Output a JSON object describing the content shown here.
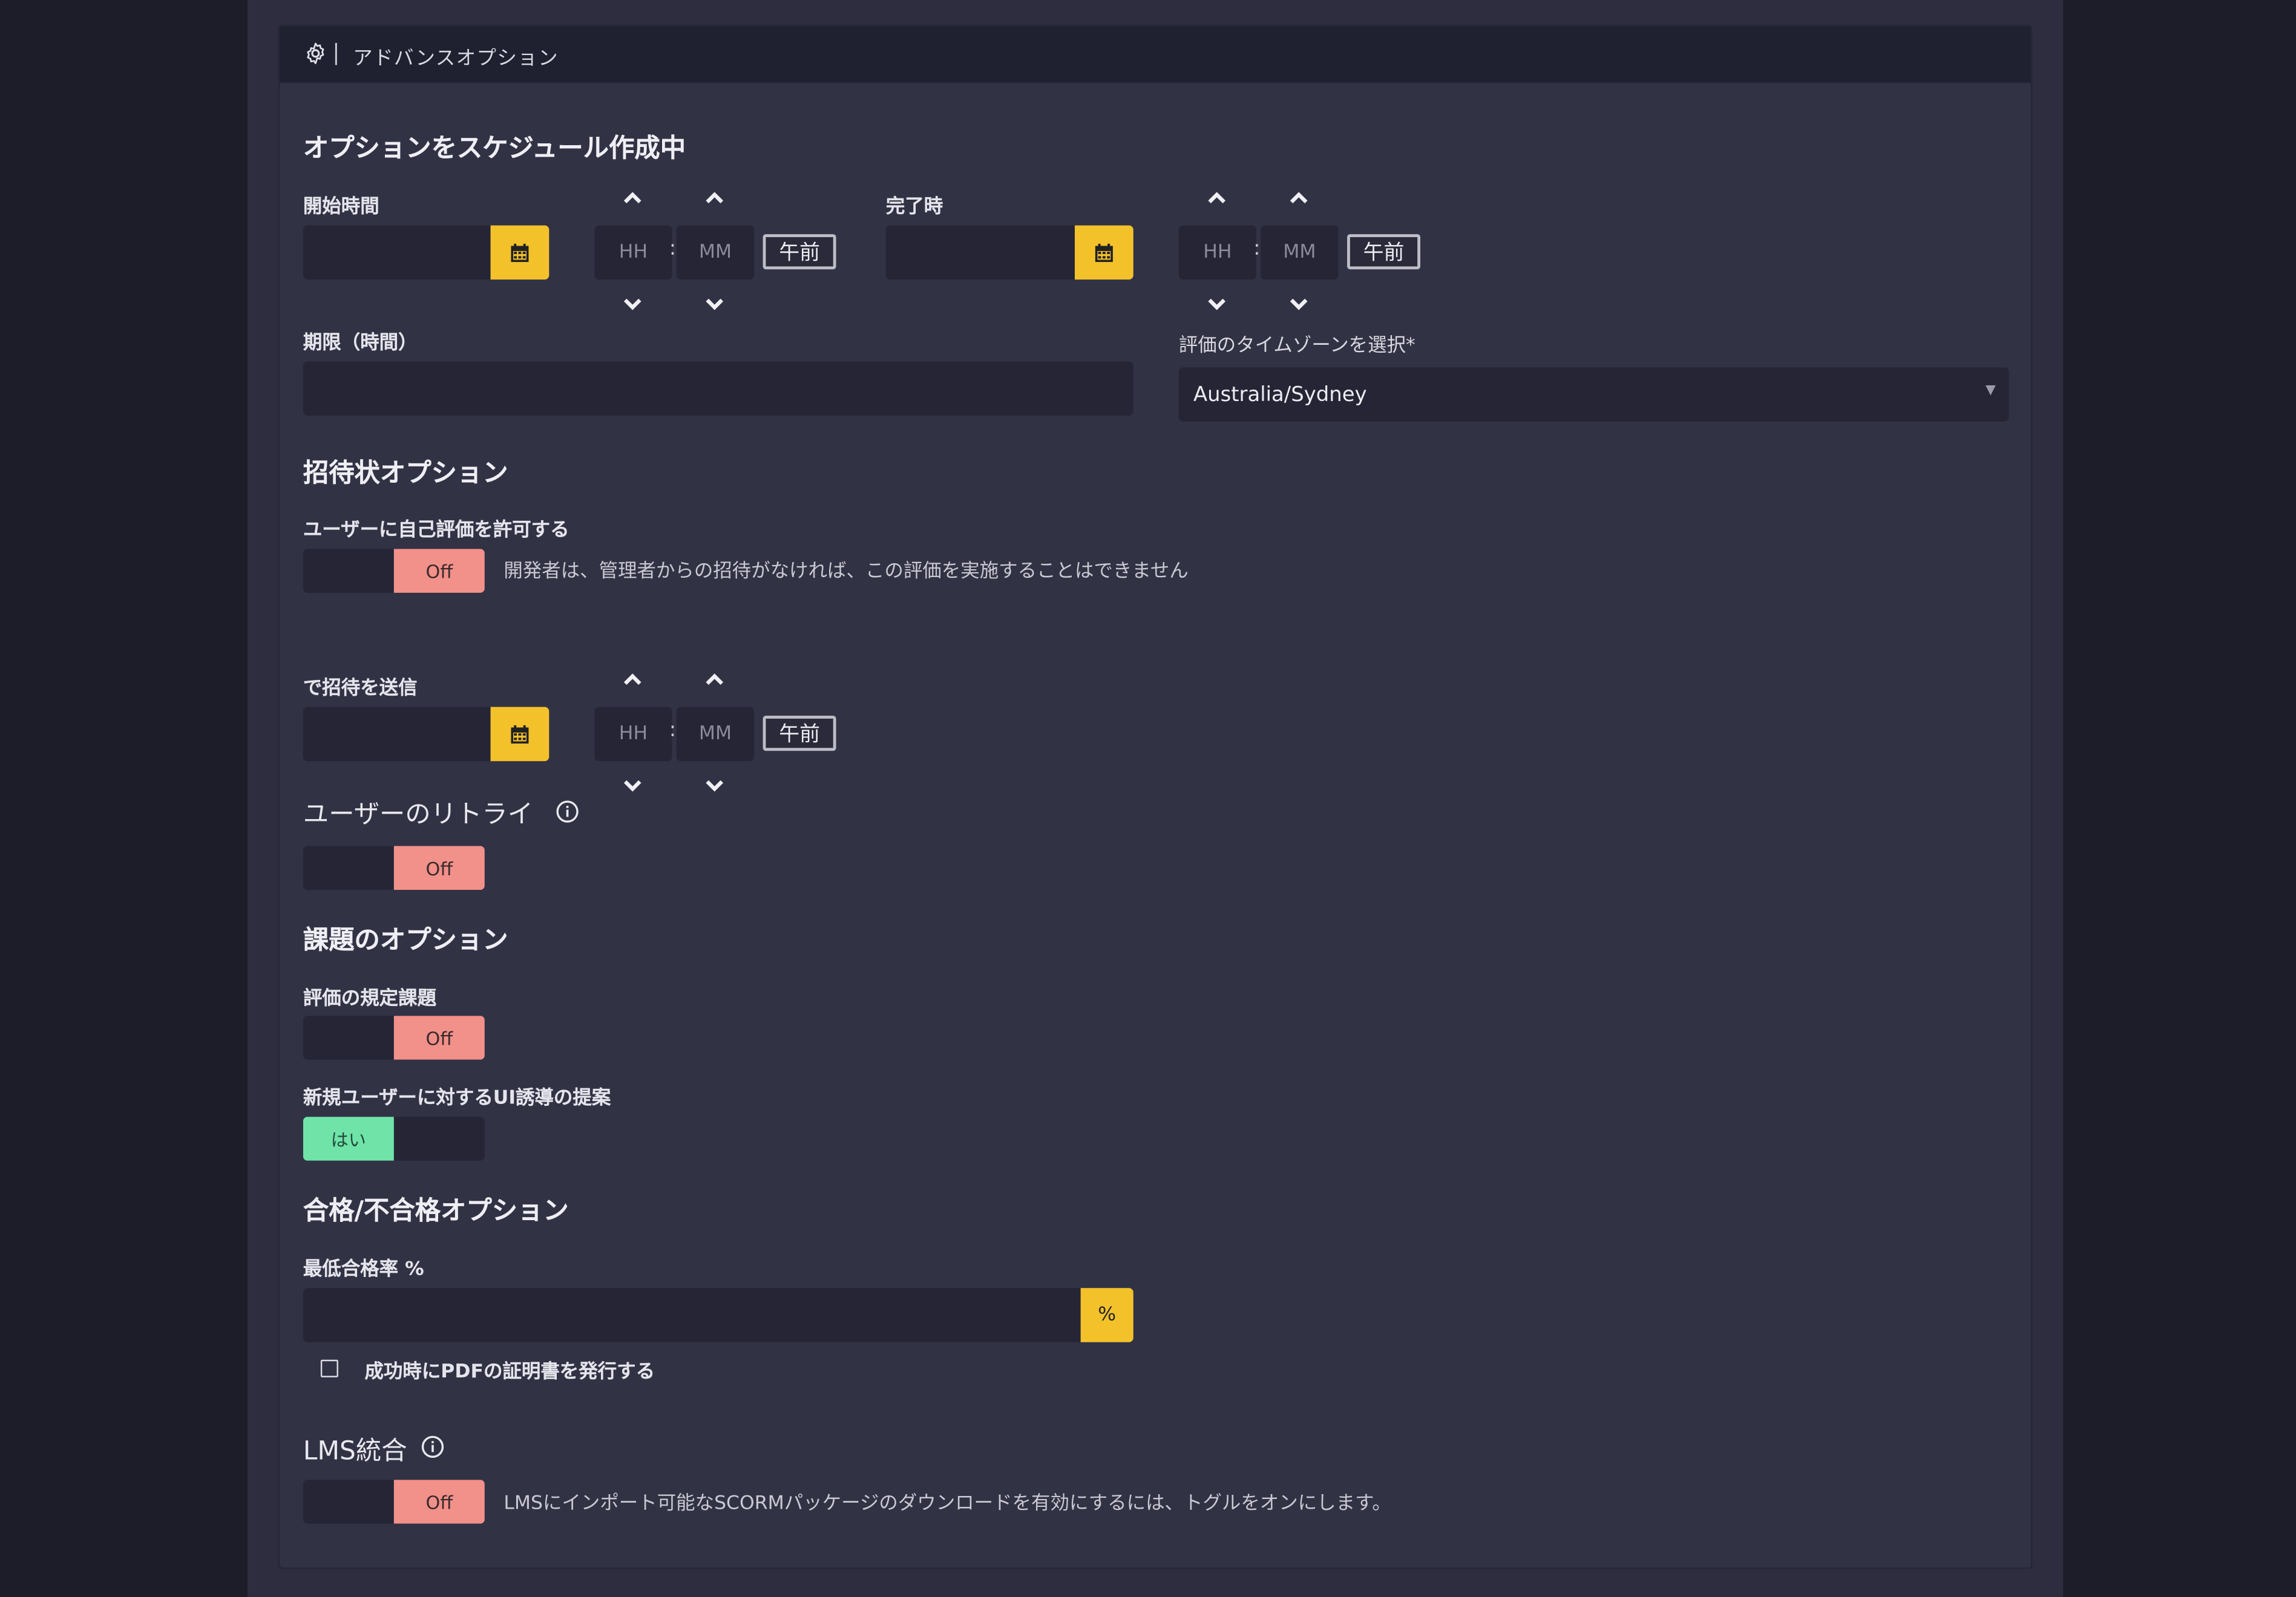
{
  "header": {
    "title": "アドバンスオプション",
    "separator": "|",
    "icon": "gear-icon"
  },
  "schedule": {
    "title": "オプションをスケジュール作成中",
    "start": {
      "label": "開始時間",
      "date_value": "",
      "hour_placeholder": "HH",
      "minute_placeholder": "MM",
      "ampm": "午前"
    },
    "end": {
      "label": "完了時",
      "date_value": "",
      "hour_placeholder": "HH",
      "minute_placeholder": "MM",
      "ampm": "午前"
    },
    "deadline": {
      "label": "期限（時間）",
      "value": ""
    },
    "timezone": {
      "label": "評価のタイムゾーンを選択*",
      "value": "Australia/Sydney"
    }
  },
  "invite": {
    "title": "招待状オプション",
    "self_assessment": {
      "label": "ユーザーに自己評価を許可する",
      "toggle_label": "Off",
      "description": "開発者は、管理者からの招待がなければ、この評価を実施することはできません"
    },
    "send_at": {
      "label": "で招待を送信",
      "date_value": "",
      "hour_placeholder": "HH",
      "minute_placeholder": "MM",
      "ampm": "午前"
    },
    "retry": {
      "label": "ユーザーのリトライ",
      "toggle_label": "Off"
    }
  },
  "tasks": {
    "title": "課題のオプション",
    "default_task": {
      "label": "評価の規定課題",
      "toggle_label": "Off"
    },
    "ui_guidance": {
      "label": "新規ユーザーに対するUI誘導の提案",
      "toggle_label": "はい"
    }
  },
  "pass_fail": {
    "title": "合格/不合格オプション",
    "min_rate": {
      "label": "最低合格率 %",
      "value": "",
      "unit": "%"
    },
    "certificate": {
      "label": "成功時にPDFの証明書を発行する",
      "checked": false
    }
  },
  "lms": {
    "label": "LMS統合",
    "toggle_label": "Off",
    "description": "LMSにインポート可能なSCORMパッケージのダウンロードを有効にするには、トグルをオンにします。"
  },
  "colors": {
    "accent": "#f3c22b",
    "off": "#f2908a",
    "on": "#6fe3a8",
    "panel": "#323245",
    "input": "#252536"
  }
}
